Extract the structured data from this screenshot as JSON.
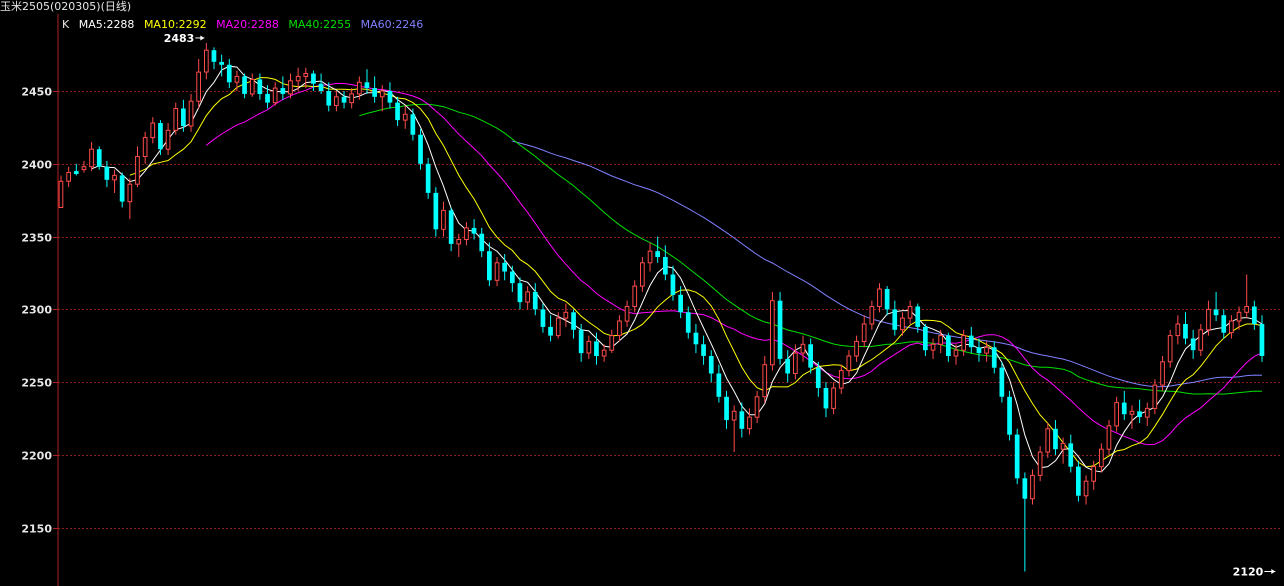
{
  "title": "玉米2505(020305)(日线)",
  "legend": {
    "k": "K",
    "ma5": "MA5:2288",
    "ma10": "MA10:2292",
    "ma20": "MA20:2288",
    "ma40": "MA40:2255",
    "ma60": "MA60:2246"
  },
  "colors": {
    "background": "#000000",
    "up": "#ff4b4b",
    "down": "#00ffff",
    "grid": "#8b1a1a",
    "axis": "#b02020",
    "axis_text": "#e6e6e6",
    "ma5": "#ffffff",
    "ma10": "#ffff00",
    "ma20": "#ff00ff",
    "ma40": "#00e000",
    "ma60": "#8080ff"
  },
  "chart_data": {
    "type": "candlestick",
    "y_ticks": [
      2150,
      2200,
      2250,
      2300,
      2350,
      2400,
      2450
    ],
    "ylim": [
      2125,
      2500
    ],
    "grid": true,
    "annotations": {
      "high_label": "2483",
      "high_value": 2483,
      "high_index": 19,
      "low_label": "2120",
      "low_value": 2120,
      "low_index": 159
    },
    "candles": [
      [
        2370,
        2392,
        2370,
        2388
      ],
      [
        2388,
        2398,
        2384,
        2394
      ],
      [
        2395,
        2400,
        2392,
        2393
      ],
      [
        2396,
        2402,
        2394,
        2398
      ],
      [
        2398,
        2415,
        2395,
        2410
      ],
      [
        2410,
        2412,
        2396,
        2398
      ],
      [
        2398,
        2402,
        2384,
        2389
      ],
      [
        2389,
        2396,
        2380,
        2392
      ],
      [
        2392,
        2394,
        2370,
        2374
      ],
      [
        2374,
        2390,
        2362,
        2386
      ],
      [
        2386,
        2412,
        2384,
        2405
      ],
      [
        2405,
        2422,
        2400,
        2418
      ],
      [
        2418,
        2432,
        2414,
        2428
      ],
      [
        2428,
        2430,
        2406,
        2410
      ],
      [
        2410,
        2428,
        2406,
        2423
      ],
      [
        2423,
        2442,
        2420,
        2438
      ],
      [
        2438,
        2444,
        2422,
        2426
      ],
      [
        2426,
        2448,
        2422,
        2443
      ],
      [
        2443,
        2472,
        2438,
        2463
      ],
      [
        2463,
        2483,
        2458,
        2478
      ],
      [
        2478,
        2480,
        2465,
        2470
      ],
      [
        2470,
        2475,
        2460,
        2468
      ],
      [
        2468,
        2472,
        2452,
        2456
      ],
      [
        2456,
        2464,
        2450,
        2460
      ],
      [
        2460,
        2462,
        2445,
        2448
      ],
      [
        2448,
        2462,
        2446,
        2458
      ],
      [
        2458,
        2462,
        2444,
        2448
      ],
      [
        2448,
        2454,
        2438,
        2442
      ],
      [
        2442,
        2456,
        2440,
        2452
      ],
      [
        2452,
        2460,
        2444,
        2448
      ],
      [
        2448,
        2462,
        2445,
        2457
      ],
      [
        2457,
        2466,
        2450,
        2460
      ],
      [
        2460,
        2466,
        2452,
        2462
      ],
      [
        2462,
        2464,
        2450,
        2455
      ],
      [
        2455,
        2462,
        2448,
        2450
      ],
      [
        2450,
        2456,
        2436,
        2440
      ],
      [
        2440,
        2450,
        2436,
        2446
      ],
      [
        2446,
        2450,
        2438,
        2442
      ],
      [
        2442,
        2452,
        2438,
        2448
      ],
      [
        2448,
        2460,
        2444,
        2456
      ],
      [
        2456,
        2465,
        2448,
        2452
      ],
      [
        2452,
        2460,
        2442,
        2446
      ],
      [
        2446,
        2454,
        2436,
        2450
      ],
      [
        2450,
        2456,
        2438,
        2442
      ],
      [
        2442,
        2446,
        2426,
        2430
      ],
      [
        2430,
        2440,
        2424,
        2434
      ],
      [
        2434,
        2438,
        2416,
        2420
      ],
      [
        2420,
        2424,
        2396,
        2400
      ],
      [
        2400,
        2404,
        2376,
        2380
      ],
      [
        2380,
        2384,
        2350,
        2355
      ],
      [
        2355,
        2374,
        2350,
        2368
      ],
      [
        2368,
        2370,
        2340,
        2345
      ],
      [
        2345,
        2352,
        2336,
        2348
      ],
      [
        2348,
        2360,
        2344,
        2356
      ],
      [
        2356,
        2362,
        2348,
        2352
      ],
      [
        2352,
        2356,
        2336,
        2340
      ],
      [
        2340,
        2346,
        2316,
        2320
      ],
      [
        2320,
        2336,
        2316,
        2332
      ],
      [
        2332,
        2338,
        2320,
        2326
      ],
      [
        2326,
        2330,
        2312,
        2318
      ],
      [
        2318,
        2322,
        2300,
        2305
      ],
      [
        2305,
        2316,
        2300,
        2312
      ],
      [
        2312,
        2318,
        2296,
        2300
      ],
      [
        2300,
        2304,
        2284,
        2288
      ],
      [
        2288,
        2296,
        2278,
        2282
      ],
      [
        2282,
        2298,
        2280,
        2294
      ],
      [
        2294,
        2304,
        2288,
        2298
      ],
      [
        2298,
        2300,
        2280,
        2286
      ],
      [
        2286,
        2290,
        2264,
        2270
      ],
      [
        2270,
        2282,
        2266,
        2278
      ],
      [
        2278,
        2284,
        2262,
        2268
      ],
      [
        2268,
        2276,
        2264,
        2272
      ],
      [
        2272,
        2286,
        2270,
        2282
      ],
      [
        2282,
        2296,
        2278,
        2292
      ],
      [
        2292,
        2306,
        2288,
        2302
      ],
      [
        2302,
        2320,
        2298,
        2316
      ],
      [
        2316,
        2336,
        2312,
        2332
      ],
      [
        2332,
        2346,
        2326,
        2340
      ],
      [
        2340,
        2350,
        2332,
        2336
      ],
      [
        2336,
        2344,
        2320,
        2324
      ],
      [
        2324,
        2330,
        2306,
        2310
      ],
      [
        2310,
        2316,
        2294,
        2298
      ],
      [
        2298,
        2302,
        2280,
        2284
      ],
      [
        2284,
        2290,
        2270,
        2276
      ],
      [
        2276,
        2282,
        2262,
        2268
      ],
      [
        2268,
        2272,
        2250,
        2256
      ],
      [
        2256,
        2262,
        2236,
        2240
      ],
      [
        2240,
        2244,
        2218,
        2224
      ],
      [
        2224,
        2234,
        2202,
        2230
      ],
      [
        2230,
        2236,
        2212,
        2218
      ],
      [
        2218,
        2232,
        2214,
        2226
      ],
      [
        2226,
        2244,
        2222,
        2240
      ],
      [
        2240,
        2268,
        2236,
        2262
      ],
      [
        2262,
        2312,
        2258,
        2306
      ],
      [
        2306,
        2312,
        2262,
        2266
      ],
      [
        2266,
        2272,
        2250,
        2256
      ],
      [
        2256,
        2276,
        2252,
        2270
      ],
      [
        2270,
        2282,
        2264,
        2276
      ],
      [
        2276,
        2280,
        2256,
        2260
      ],
      [
        2260,
        2264,
        2240,
        2246
      ],
      [
        2246,
        2250,
        2226,
        2232
      ],
      [
        2232,
        2250,
        2228,
        2246
      ],
      [
        2246,
        2262,
        2242,
        2258
      ],
      [
        2258,
        2272,
        2254,
        2268
      ],
      [
        2268,
        2282,
        2264,
        2278
      ],
      [
        2278,
        2296,
        2274,
        2290
      ],
      [
        2290,
        2306,
        2286,
        2302
      ],
      [
        2302,
        2318,
        2298,
        2314
      ],
      [
        2314,
        2316,
        2296,
        2300
      ],
      [
        2300,
        2306,
        2282,
        2286
      ],
      [
        2286,
        2298,
        2282,
        2294
      ],
      [
        2294,
        2306,
        2290,
        2302
      ],
      [
        2302,
        2304,
        2284,
        2288
      ],
      [
        2288,
        2290,
        2268,
        2272
      ],
      [
        2272,
        2280,
        2266,
        2276
      ],
      [
        2276,
        2286,
        2270,
        2282
      ],
      [
        2282,
        2284,
        2264,
        2268
      ],
      [
        2268,
        2276,
        2262,
        2272
      ],
      [
        2272,
        2286,
        2268,
        2282
      ],
      [
        2282,
        2288,
        2270,
        2274
      ],
      [
        2274,
        2280,
        2264,
        2270
      ],
      [
        2270,
        2278,
        2264,
        2274
      ],
      [
        2274,
        2278,
        2256,
        2260
      ],
      [
        2260,
        2264,
        2236,
        2240
      ],
      [
        2240,
        2244,
        2210,
        2214
      ],
      [
        2214,
        2218,
        2180,
        2184
      ],
      [
        2184,
        2188,
        2120,
        2170
      ],
      [
        2170,
        2190,
        2166,
        2186
      ],
      [
        2186,
        2206,
        2182,
        2202
      ],
      [
        2202,
        2222,
        2198,
        2218
      ],
      [
        2218,
        2224,
        2200,
        2204
      ],
      [
        2204,
        2212,
        2194,
        2208
      ],
      [
        2208,
        2214,
        2188,
        2192
      ],
      [
        2192,
        2196,
        2168,
        2172
      ],
      [
        2172,
        2186,
        2166,
        2182
      ],
      [
        2182,
        2196,
        2176,
        2192
      ],
      [
        2192,
        2208,
        2188,
        2204
      ],
      [
        2204,
        2224,
        2200,
        2220
      ],
      [
        2220,
        2240,
        2216,
        2236
      ],
      [
        2236,
        2244,
        2224,
        2228
      ],
      [
        2228,
        2234,
        2218,
        2230
      ],
      [
        2230,
        2238,
        2222,
        2226
      ],
      [
        2226,
        2236,
        2220,
        2232
      ],
      [
        2232,
        2252,
        2228,
        2248
      ],
      [
        2248,
        2268,
        2244,
        2264
      ],
      [
        2264,
        2286,
        2260,
        2282
      ],
      [
        2282,
        2296,
        2276,
        2290
      ],
      [
        2290,
        2298,
        2276,
        2280
      ],
      [
        2280,
        2286,
        2266,
        2272
      ],
      [
        2272,
        2290,
        2268,
        2286
      ],
      [
        2286,
        2306,
        2282,
        2300
      ],
      [
        2300,
        2312,
        2292,
        2296
      ],
      [
        2296,
        2300,
        2280,
        2284
      ],
      [
        2284,
        2296,
        2280,
        2292
      ],
      [
        2292,
        2302,
        2286,
        2298
      ],
      [
        2298,
        2324,
        2294,
        2302
      ],
      [
        2302,
        2306,
        2286,
        2290
      ],
      [
        2290,
        2296,
        2264,
        2268
      ]
    ]
  }
}
